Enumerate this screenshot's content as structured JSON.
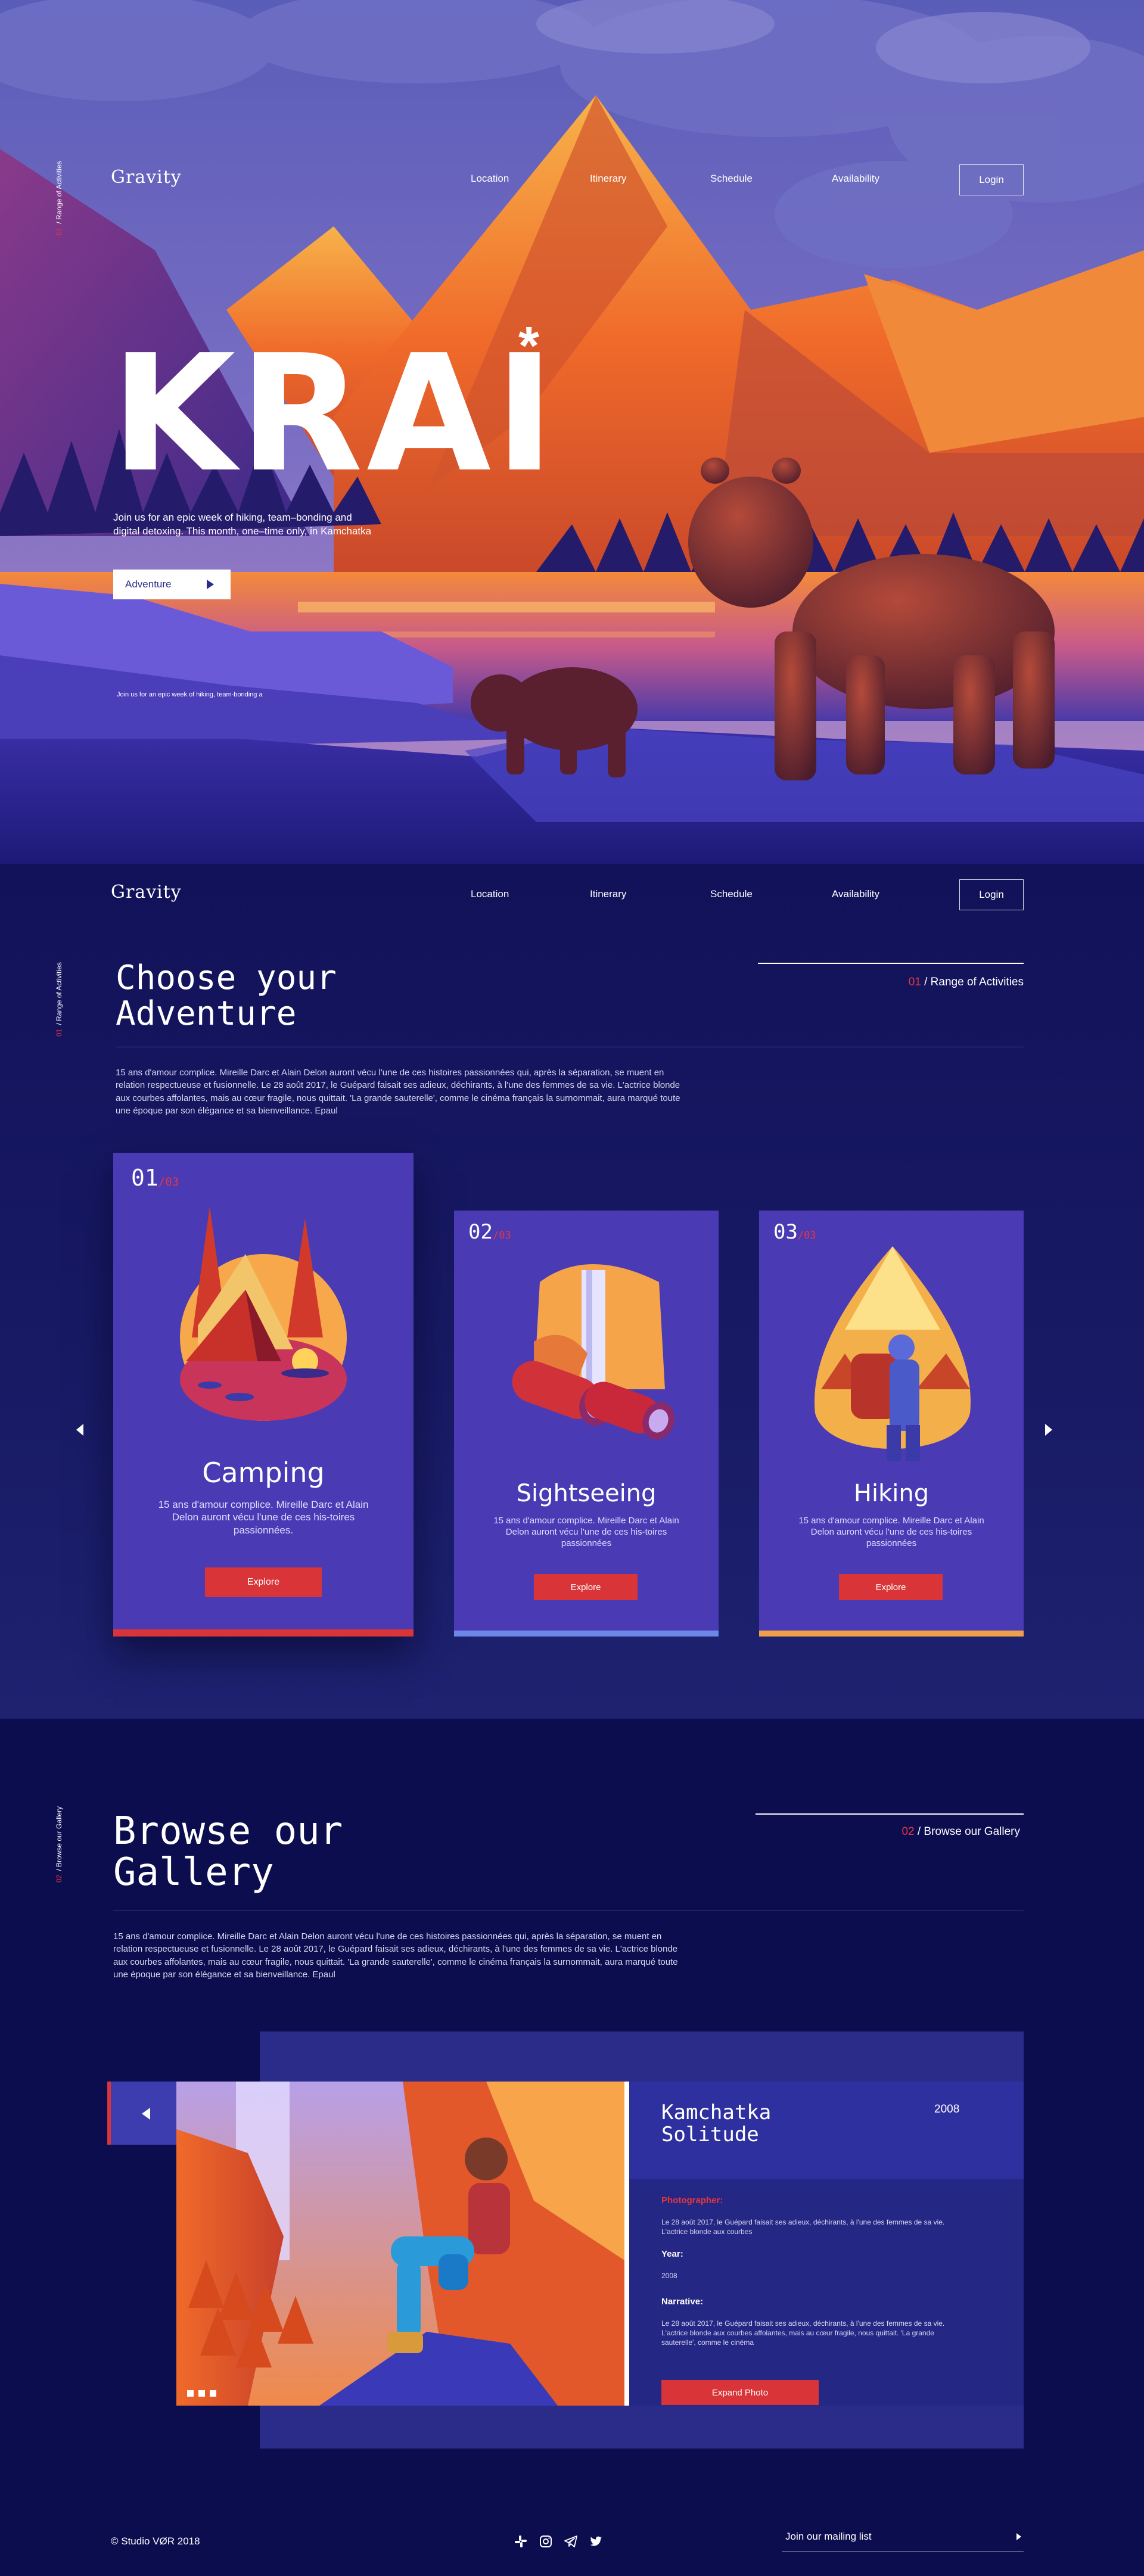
{
  "nav": {
    "logo": "Gravity",
    "items": [
      "Location",
      "Itinerary",
      "Schedule",
      "Availability"
    ],
    "login": "Login"
  },
  "hero": {
    "side_label_num": "01",
    "side_label": "/ Range of Activities",
    "title": "KRAI",
    "asterisk": "*",
    "intro": "Join us for an epic week of hiking, team–bonding and digital detoxing. This month, one–time only, in Kamchatka",
    "button": "Adventure",
    "small_text": "Join us for an epic week of hiking, team-bonding a"
  },
  "activities": {
    "side_label_num": "01",
    "side_label": "/ Range of Activities",
    "title_line1": "Choose your",
    "title_line2": "Adventure",
    "tag_num": "01",
    "tag_text": "/ Range of Activities",
    "paragraph": "15 ans d'amour complice. Mireille Darc et Alain Delon auront vécu l'une de ces histoires passionnées qui, après la séparation, se muent en relation respectueuse et fusionnelle. Le 28 août 2017, le Guépard faisait ses adieux, déchirants, à l'une des femmes de sa vie. L'actrice blonde aux courbes affolantes, mais au cœur fragile, nous quittait. 'La grande sauterelle', comme le cinéma français la surnommait, aura marqué toute une époque par son élégance et sa bienveillance. Epaul",
    "cards": [
      {
        "num": "01",
        "total": "/03",
        "title": "Camping",
        "desc": "15 ans d'amour complice. Mireille Darc et Alain Delon auront vécu l'une de ces his-toires passionnées.",
        "button": "Explore",
        "bar_color": "#d93438"
      },
      {
        "num": "02",
        "total": "/03",
        "title": "Sightseeing",
        "desc": "15 ans d'amour complice. Mireille Darc et Alain Delon auront vécu l'une de ces his-toires passionnées",
        "button": "Explore",
        "bar_color": "#6e86e8"
      },
      {
        "num": "03",
        "total": "/03",
        "title": "Hiking",
        "desc": "15 ans d'amour complice. Mireille Darc et Alain Delon auront vécu l'une de ces his-toires passionnées",
        "button": "Explore",
        "bar_color": "#f0a04a"
      }
    ]
  },
  "gallery": {
    "side_label_num": "02",
    "side_label": "/ Browse our Gallery",
    "title_line1": "Browse our",
    "title_line2": "Gallery",
    "tag_num": "02",
    "tag_text": "/ Browse our Gallery",
    "paragraph": "15 ans d'amour complice. Mireille Darc et Alain Delon auront vécu l'une de ces histoires passionnées qui, après la séparation, se muent en relation respectueuse et fusionnelle. Le 28 août 2017, le Guépard faisait ses adieux, déchirants, à l'une des femmes de sa vie. L'actrice blonde aux courbes affolantes, mais au cœur fragile, nous quittait. 'La grande sauterelle', comme le cinéma français la surnommait, aura marqué toute une époque par son élégance et sa bienveillance. Epaul",
    "photo_title_line1": "Kamchatka",
    "photo_title_line2": "Solitude",
    "photo_year": "2008",
    "photographer_label": "Photographer:",
    "photographer_text": "Le 28 août 2017, le Guépard faisait ses adieux, déchirants, à l'une des femmes de sa vie. L'actrice blonde aux courbes",
    "year_label": "Year:",
    "year_value": "2008",
    "narrative_label": "Narrative:",
    "narrative_text": "Le 28 août 2017, le Guépard faisait ses adieux, déchirants, à l'une des femmes de sa vie. L'actrice blonde aux courbes affolantes, mais au cœur fragile, nous quittait. 'La grande sauterelle', comme le cinéma",
    "expand_button": "Expand Photo"
  },
  "footer": {
    "copyright": "© Studio VØR 2018",
    "mailing": "Join our mailing list",
    "social": [
      "slack-icon",
      "instagram-icon",
      "telegram-icon",
      "twitter-icon"
    ]
  },
  "colors": {
    "navy": "#0c0d4f",
    "card_purple": "#4a3bb5",
    "red": "#d93438",
    "orange": "#f0a04a",
    "blue_bar": "#6e86e8"
  }
}
